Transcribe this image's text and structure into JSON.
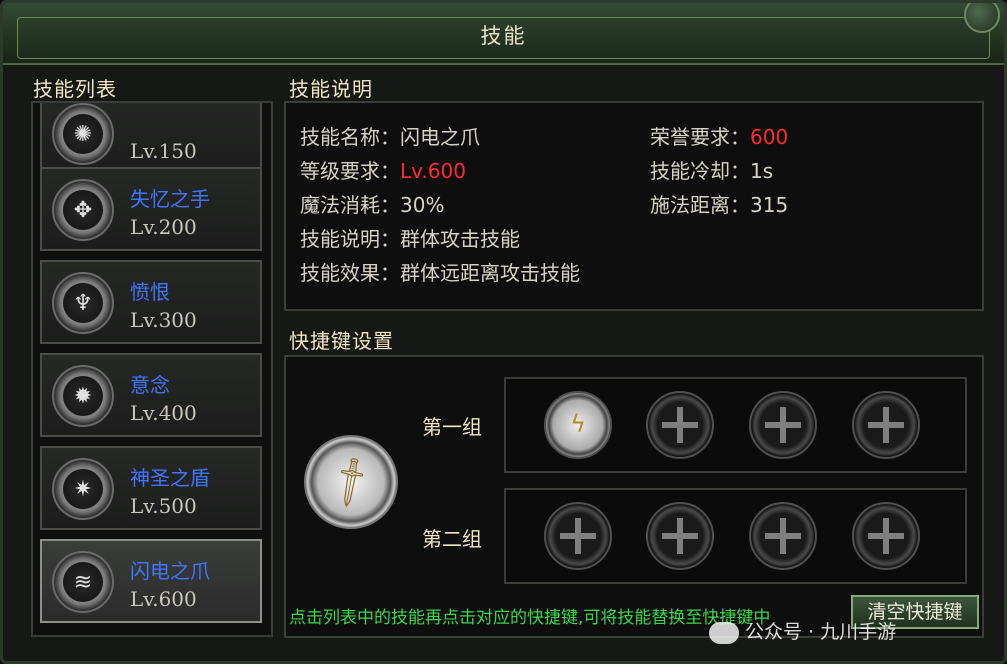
{
  "window": {
    "title": "技能"
  },
  "skill_list": {
    "title": "技能列表",
    "items": [
      {
        "name": "",
        "level": "Lv.150",
        "icon": "sun-rays-icon",
        "selected": false
      },
      {
        "name": "失忆之手",
        "level": "Lv.200",
        "icon": "wings-icon",
        "selected": false
      },
      {
        "name": "愤恨",
        "level": "Lv.300",
        "icon": "demon-head-icon",
        "selected": false
      },
      {
        "name": "意念",
        "level": "Lv.400",
        "icon": "swirl-icon",
        "selected": false
      },
      {
        "name": "神圣之盾",
        "level": "Lv.500",
        "icon": "starburst-icon",
        "selected": false
      },
      {
        "name": "闪电之爪",
        "level": "Lv.600",
        "icon": "claw-icon",
        "selected": true
      }
    ]
  },
  "description": {
    "title": "技能说明",
    "rows": {
      "name_label": "技能名称：",
      "name_value": "闪电之爪",
      "level_label": "等级要求：",
      "level_value": "Lv.600",
      "mana_label": "魔法消耗：",
      "mana_value": "30%",
      "desc_label": "技能说明：",
      "desc_value": "群体攻击技能",
      "effect_label": "技能效果：",
      "effect_value": "群体远距离攻击技能",
      "honor_label": "荣誉要求：",
      "honor_value": "600",
      "cooldown_label": "技能冷却：",
      "cooldown_value": "1s",
      "range_label": "施法距离：",
      "range_value": "315"
    },
    "highlight_color": "#ff2a2a"
  },
  "hotkeys": {
    "title": "快捷键设置",
    "group1_label": "第一组",
    "group2_label": "第二组",
    "group1_slots": [
      "lightning-claw-icon",
      "empty-slot",
      "empty-slot",
      "empty-slot"
    ],
    "group2_slots": [
      "empty-slot",
      "empty-slot",
      "empty-slot",
      "empty-slot"
    ],
    "hint": "点击列表中的技能再点击对应的快捷键,可将技能替换至快捷键中",
    "clear_button": "清空快捷键"
  },
  "watermark": "公众号 · 九川手游"
}
